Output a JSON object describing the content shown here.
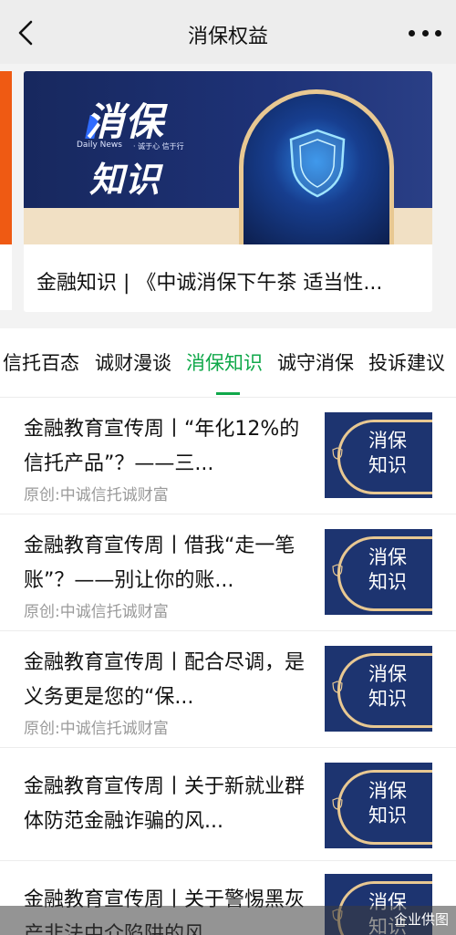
{
  "nav": {
    "title": "消保权益",
    "back_icon": "chevron-left-icon",
    "more_icon": "more-dots-icon"
  },
  "carousel": {
    "banner": {
      "line1": "消保",
      "line2": "知识",
      "daily": "Daily News",
      "slogan": "· 诚于心 信于行"
    },
    "card_title": "金融知识 | 《中诚消保下午茶 适当性..."
  },
  "tabs": [
    {
      "label": "信托百态",
      "active": false
    },
    {
      "label": "诚财漫谈",
      "active": false
    },
    {
      "label": "消保知识",
      "active": true
    },
    {
      "label": "诚守消保",
      "active": false
    },
    {
      "label": "投诉建议",
      "active": false
    }
  ],
  "accent_color": "#10a84a",
  "articles": [
    {
      "title": "金融教育宣传周丨“年化12%的信托产品”？——三...",
      "source": "原创:中诚信托诚财富",
      "thumb_text": "消保知识"
    },
    {
      "title": "金融教育宣传周丨借我“走一笔账”？——别让你的账...",
      "source": "原创:中诚信托诚财富",
      "thumb_text": "消保知识"
    },
    {
      "title": "金融教育宣传周丨配合尽调，是义务更是您的“保...",
      "source": "原创:中诚信托诚财富",
      "thumb_text": "消保知识"
    },
    {
      "title": "金融教育宣传周丨关于新就业群体防范金融诈骗的风...",
      "source": "",
      "thumb_text": "消保知识"
    },
    {
      "title": "金融教育宣传周丨关于警惕黑灰产非法中介陷阱的风",
      "source": "",
      "thumb_text": "消保知识"
    }
  ],
  "footer": {
    "credit": "企业供图"
  }
}
